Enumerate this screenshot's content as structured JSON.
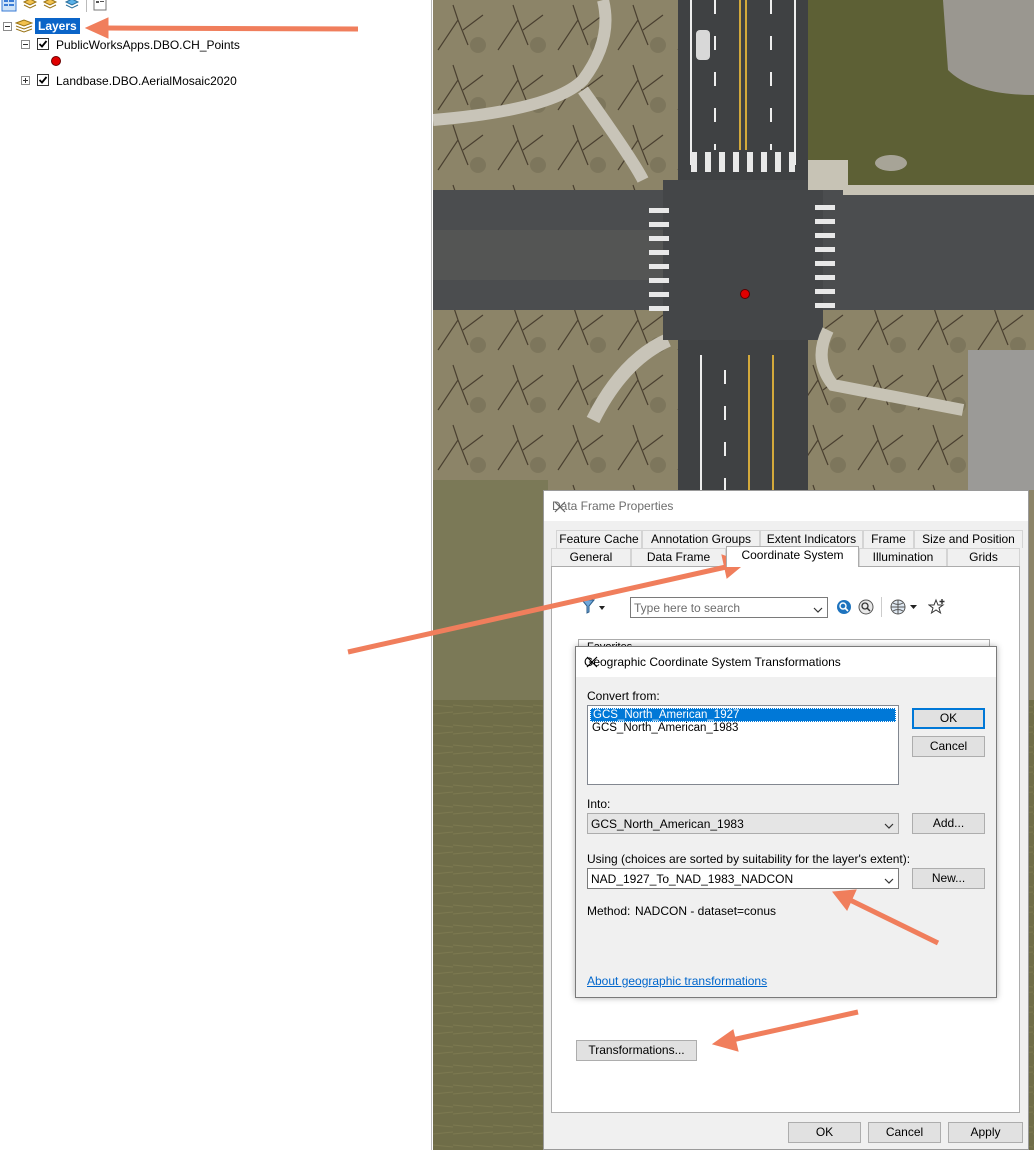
{
  "toc": {
    "root_label": "Layers",
    "layers": [
      {
        "name": "PublicWorksApps.DBO.CH_Points",
        "checked": true,
        "expanded": true
      },
      {
        "name": "Landbase.DBO.AerialMosaic2020",
        "checked": true,
        "expanded": false
      }
    ],
    "point_symbol_color": "#e00000"
  },
  "data_frame_dialog": {
    "title": "Data Frame Properties",
    "tabs_row1": [
      "Feature Cache",
      "Annotation Groups",
      "Extent Indicators",
      "Frame",
      "Size and Position"
    ],
    "tabs_row2": [
      "General",
      "Data Frame",
      "Coordinate System",
      "Illumination",
      "Grids"
    ],
    "active_tab": "Coordinate System",
    "search_placeholder": "Type here to search",
    "tree_partial_label": "Favorites",
    "transformations_button": "Transformations...",
    "ok": "OK",
    "cancel": "Cancel",
    "apply": "Apply"
  },
  "gcs_dialog": {
    "title": "Geographic Coordinate System Transformations",
    "convert_from_label": "Convert from:",
    "convert_from_items": [
      "GCS_North_American_1927",
      "GCS_North_American_1983"
    ],
    "selected_index": 0,
    "into_label": "Into:",
    "into_value": "GCS_North_American_1983",
    "using_label": "Using (choices are sorted by suitability for the layer's extent):",
    "using_value": "NAD_1927_To_NAD_1983_NADCON",
    "method_label": "Method:",
    "method_value": "NADCON - dataset=conus",
    "about_link": "About geographic transformations",
    "ok": "OK",
    "cancel": "Cancel",
    "add": "Add...",
    "new": "New..."
  },
  "colors": {
    "annotation_arrow": "#f07e5c",
    "selection": "#0078d7",
    "map_point": "#e00000"
  }
}
